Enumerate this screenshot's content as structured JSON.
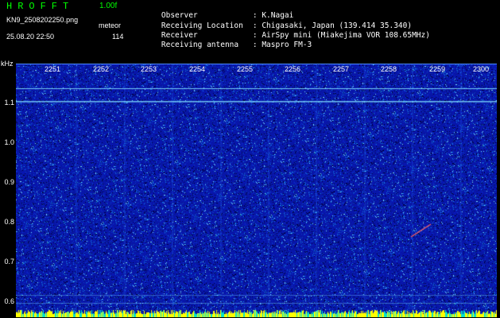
{
  "header": {
    "brand": "HROFFT",
    "version": "1.00f",
    "filename": "KN9_2508202250.png",
    "datetime": "25.08.20 22:50",
    "mode": "meteor",
    "count": "114"
  },
  "info": [
    {
      "label": "Observer",
      "value": ": K.Nagai"
    },
    {
      "label": "Receiving Location",
      "value": ": Chigasaki, Japan (139.414 35.340)"
    },
    {
      "label": "Receiver",
      "value": ": AirSpy mini (Miakejima VOR 108.65MHz)"
    },
    {
      "label": "Receiving antenna",
      "value": ": Maspro FM-3"
    }
  ],
  "y_unit": "kHz",
  "y_labels": [
    "1.1",
    "1.0",
    "0.9",
    "0.8",
    "0.7",
    "0.6"
  ],
  "time_labels": [
    "2251",
    "2252",
    "2253",
    "2254",
    "2255",
    "2256",
    "2257",
    "2258",
    "2259",
    "2300"
  ],
  "colors": {
    "background": "#000000",
    "header_green": "#00ff00",
    "spectrogram_base": "#0a19a6",
    "time_tick": "#ffff00",
    "signal_line": "#7fe0ff",
    "signal_meteor": "#ff6060"
  }
}
